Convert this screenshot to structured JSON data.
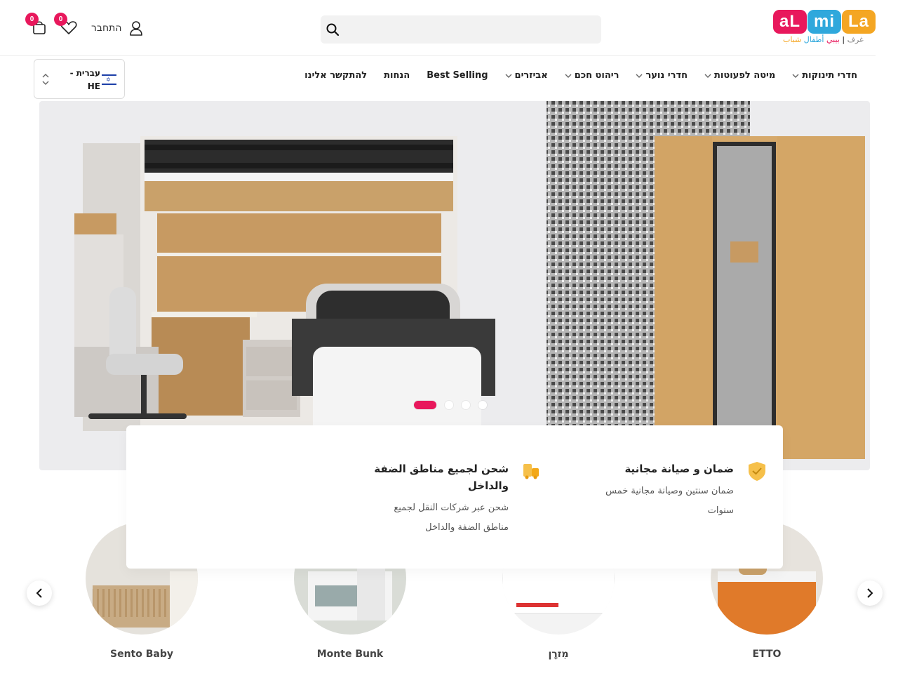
{
  "logo": {
    "letters": [
      "aL",
      "mi",
      "La"
    ],
    "tagline": [
      "غرف",
      "بيبي",
      "أطفال",
      "شباب"
    ]
  },
  "search": {
    "placeholder": "",
    "value": ""
  },
  "account": {
    "login_label": "התחבר",
    "wishlist_count": "0",
    "cart_count": "0"
  },
  "nav": {
    "items": [
      {
        "label": "חדרי תינוקות",
        "dropdown": true
      },
      {
        "label": "מיטה לפעוטות",
        "dropdown": true
      },
      {
        "label": "חדרי נוער",
        "dropdown": true
      },
      {
        "label": "ריהוט חכם",
        "dropdown": true
      },
      {
        "label": "אביזרים",
        "dropdown": true
      },
      {
        "label": "Best Selling",
        "dropdown": false
      },
      {
        "label": "הנחות",
        "dropdown": false
      },
      {
        "label": "להתקשר אלינו",
        "dropdown": false
      }
    ]
  },
  "language": {
    "label": "עברית - HE",
    "flag": "israel-flag"
  },
  "hero": {
    "slide_count": 4,
    "active_slide": 0
  },
  "features": [
    {
      "title": "ضمان و صيانة مجانية",
      "text": "ضمان سنتين وصيانة مجانية خمس سنوات",
      "icon": "shield-check-icon"
    },
    {
      "title": "شحن لجميع مناطق الضفة والداخل",
      "text": "شحن عبر شركات النقل لجميع مناطق الضفة والداخل",
      "icon": "truck-icon"
    }
  ],
  "categories": [
    {
      "label": "ETTO"
    },
    {
      "label": "מִזרָן"
    },
    {
      "label": "Monte Bunk"
    },
    {
      "label": "Sento Baby"
    }
  ],
  "colors": {
    "accent": "#e8185c",
    "logo_blue": "#2fa8dc",
    "logo_orange": "#f4a623",
    "feature_icon": "#f6c04a"
  }
}
